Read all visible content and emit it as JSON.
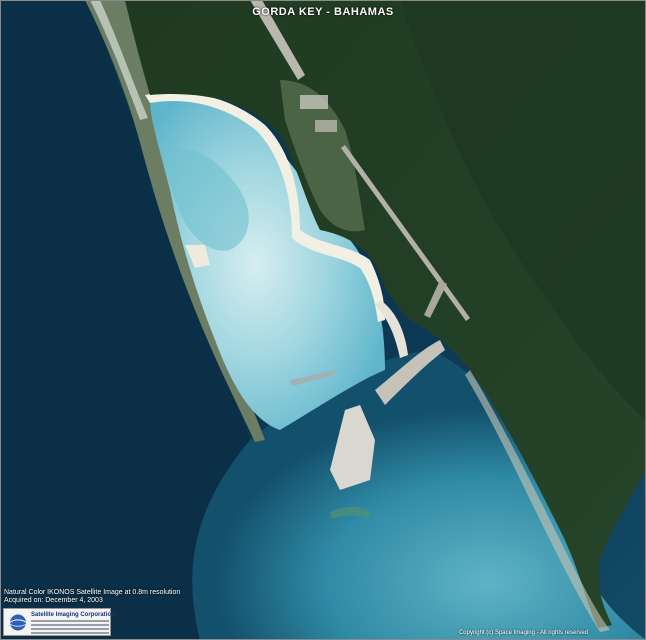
{
  "title": "GORDA KEY - BAHAMAS",
  "caption": {
    "line1": "Natural Color IKONOS Satellite Image at 0.8m resolution",
    "line2": "Acquired on: December 4, 2003"
  },
  "logo": {
    "name": "Satellite Imaging Corporation"
  },
  "copyright": "Copyright (c) Space Imaging - All rights reserved"
}
